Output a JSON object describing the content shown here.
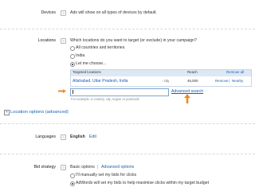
{
  "devices": {
    "label": "Devices",
    "text": "Ads will show on all types of devices by default."
  },
  "locations": {
    "label": "Locations",
    "question": "Which locations do you want to target (or exclude) in your campaign?",
    "options": [
      {
        "label": "All countries and territories",
        "selected": false
      },
      {
        "label": "India",
        "selected": false
      },
      {
        "label": "Let me choose...",
        "selected": true
      }
    ],
    "table": {
      "header_col1": "Targeted locations",
      "header_col2": "Reach",
      "header_action": "Remove all",
      "rows": [
        {
          "name": "Allahabad, Uttar Pradesh, India",
          "type": "- city",
          "reach": "46,000",
          "remove": "Remove",
          "nearby": "Nearby"
        }
      ]
    },
    "search": {
      "value": "",
      "placeholder": "For example, a country, city, region or postcode",
      "advanced_link": "Advanced search"
    },
    "arrow_color": "#f08a24"
  },
  "location_options": {
    "label": "Location options (advanced)"
  },
  "languages": {
    "label": "Languages",
    "value": "English",
    "edit": "Edit"
  },
  "bid_strategy": {
    "label": "Bid strategy",
    "modes": [
      "Basic options",
      "Advanced options"
    ],
    "separator": "|",
    "options": [
      {
        "label": "I'll manually set my bids for clicks",
        "selected": false
      },
      {
        "label": "AdWords will set my bids to help maximise clicks within my target budget",
        "selected": true
      }
    ]
  },
  "colors": {
    "link": "#1a5fb4",
    "accent": "#f08a24",
    "table_header": "#dde8f5"
  }
}
